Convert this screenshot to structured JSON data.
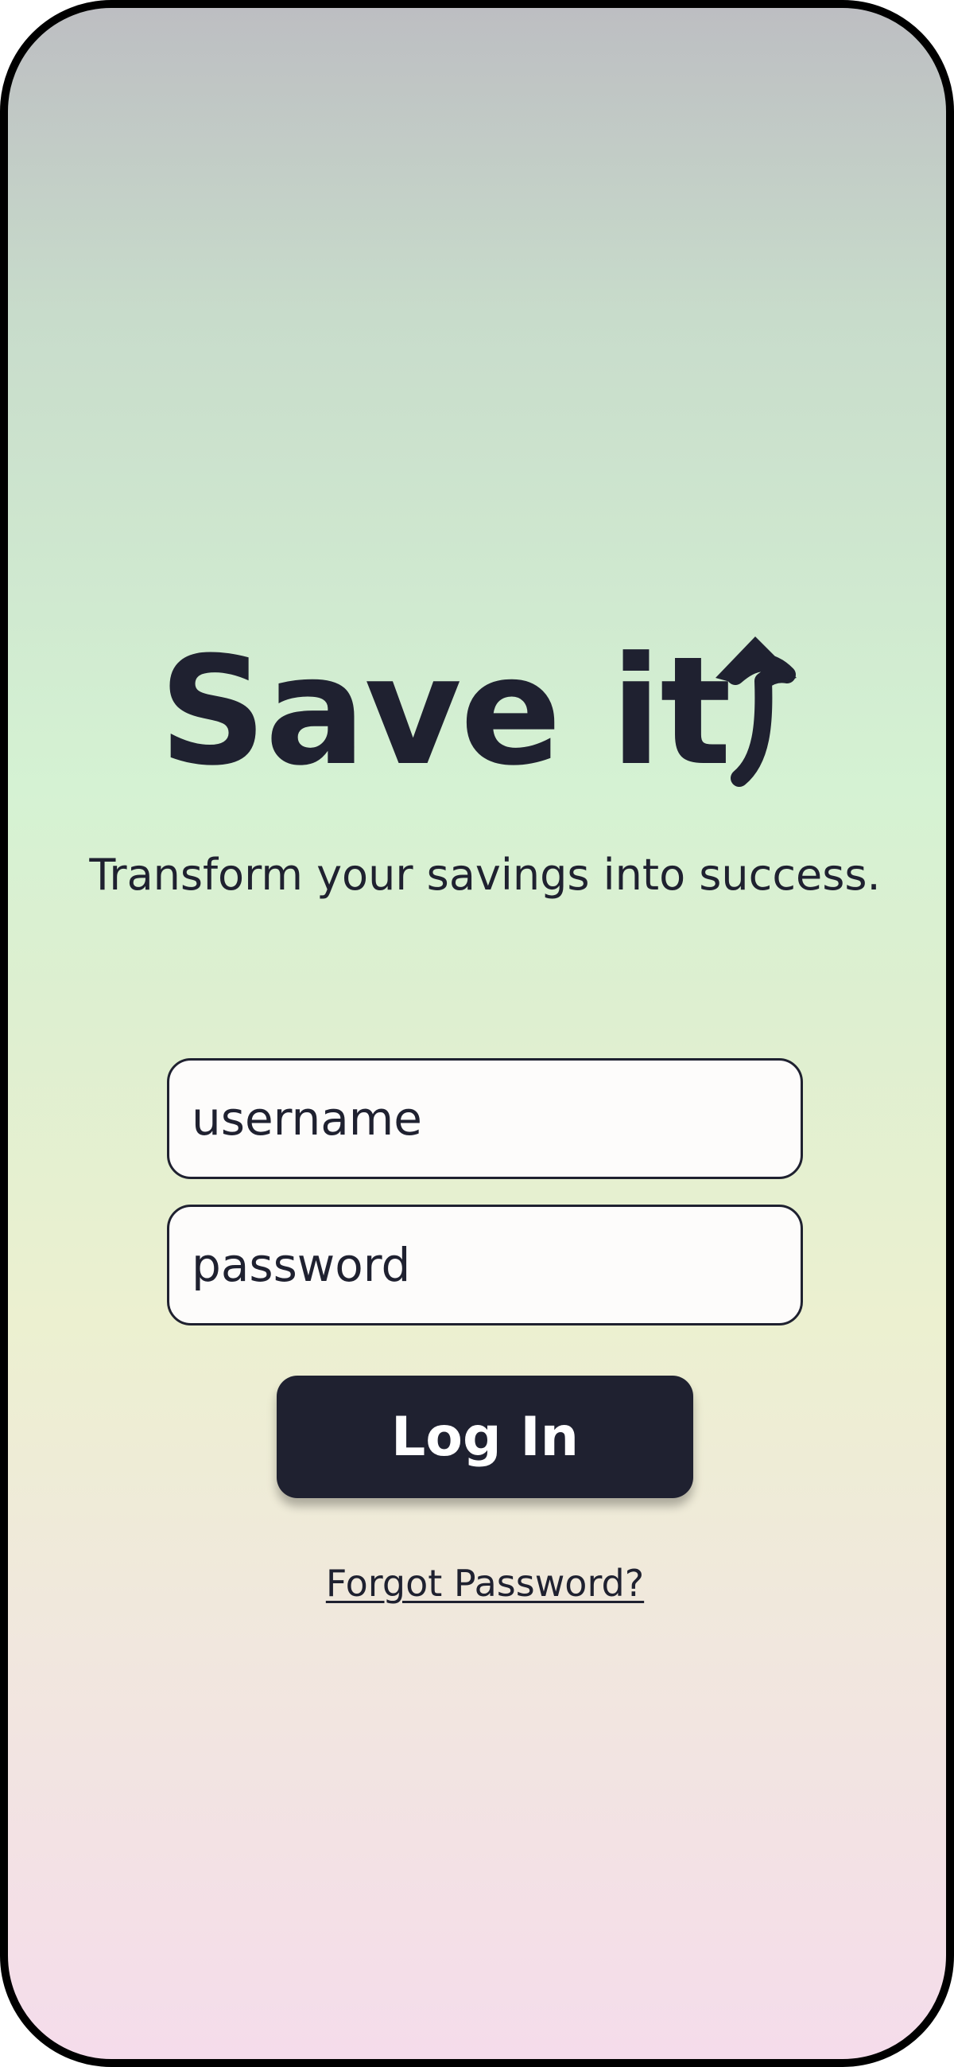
{
  "app": {
    "logo_text": "Save it",
    "tagline": "Transform your savings into success."
  },
  "form": {
    "username_placeholder": "username",
    "password_placeholder": "password",
    "login_label": "Log In",
    "forgot_label": "Forgot Password?"
  },
  "colors": {
    "text": "#1f2130",
    "button_background": "#1f2130",
    "button_text": "#ffffff",
    "gradient_top": "#bdbec2",
    "gradient_mid": "#d5f2d3",
    "gradient_bottom": "#f5dceb"
  },
  "icons": {
    "logo_arrow": "up-arrow-icon"
  }
}
